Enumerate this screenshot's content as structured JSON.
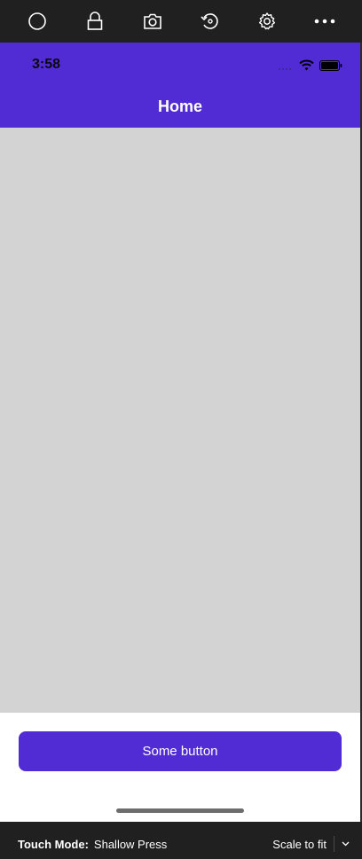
{
  "toolbar": {
    "icons": [
      "circle-icon",
      "lock-icon",
      "camera-icon",
      "rotate-icon",
      "gear-icon",
      "more-icon"
    ]
  },
  "status_bar": {
    "time": "3:58"
  },
  "nav": {
    "title": "Home"
  },
  "content": {
    "button_label": "Some button"
  },
  "footer": {
    "touch_mode_label": "Touch Mode:",
    "touch_mode_value": "Shallow Press",
    "scale_label": "Scale to fit"
  },
  "colors": {
    "accent": "#512bd4",
    "content_bg": "#d3d3d3",
    "chrome_bg": "#202020"
  }
}
